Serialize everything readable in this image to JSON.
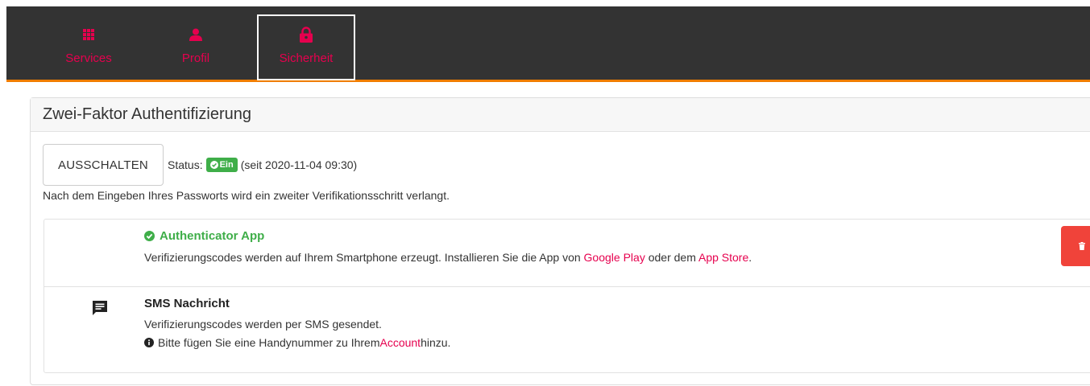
{
  "nav": {
    "items": [
      {
        "label": "Services",
        "icon": "grid-icon"
      },
      {
        "label": "Profil",
        "icon": "user-icon"
      },
      {
        "label": "Sicherheit",
        "icon": "lock-icon"
      }
    ]
  },
  "card": {
    "title": "Zwei-Faktor Authentifizierung",
    "off_button_label": "AUSSCHALTEN",
    "status_label": "Status:",
    "status_badge": "Ein",
    "status_since": "(seit 2020-11-04 09:30)",
    "info": "Nach dem Eingeben Ihres Passworts wird ein zweiter Verifikationsschritt verlangt."
  },
  "methods": {
    "auth": {
      "title": "Authenticator App",
      "desc_pre": "Verifizierungscodes werden auf Ihrem Smartphone erzeugt. Installieren Sie die App von ",
      "link1": "Google Play",
      "desc_mid": " oder dem ",
      "link2": "App Store",
      "desc_post": "."
    },
    "sms": {
      "title": "SMS Nachricht",
      "desc": "Verifizierungscodes werden per SMS gesendet.",
      "note_pre": "Bitte fügen Sie eine Handynummer zu Ihrem ",
      "note_link": "Account",
      "note_post": " hinzu."
    }
  },
  "colors": {
    "accent": "#e6004e",
    "navbar": "#333333",
    "navbar_border": "#f07d00",
    "success": "#3fae49",
    "danger": "#f0433a"
  }
}
